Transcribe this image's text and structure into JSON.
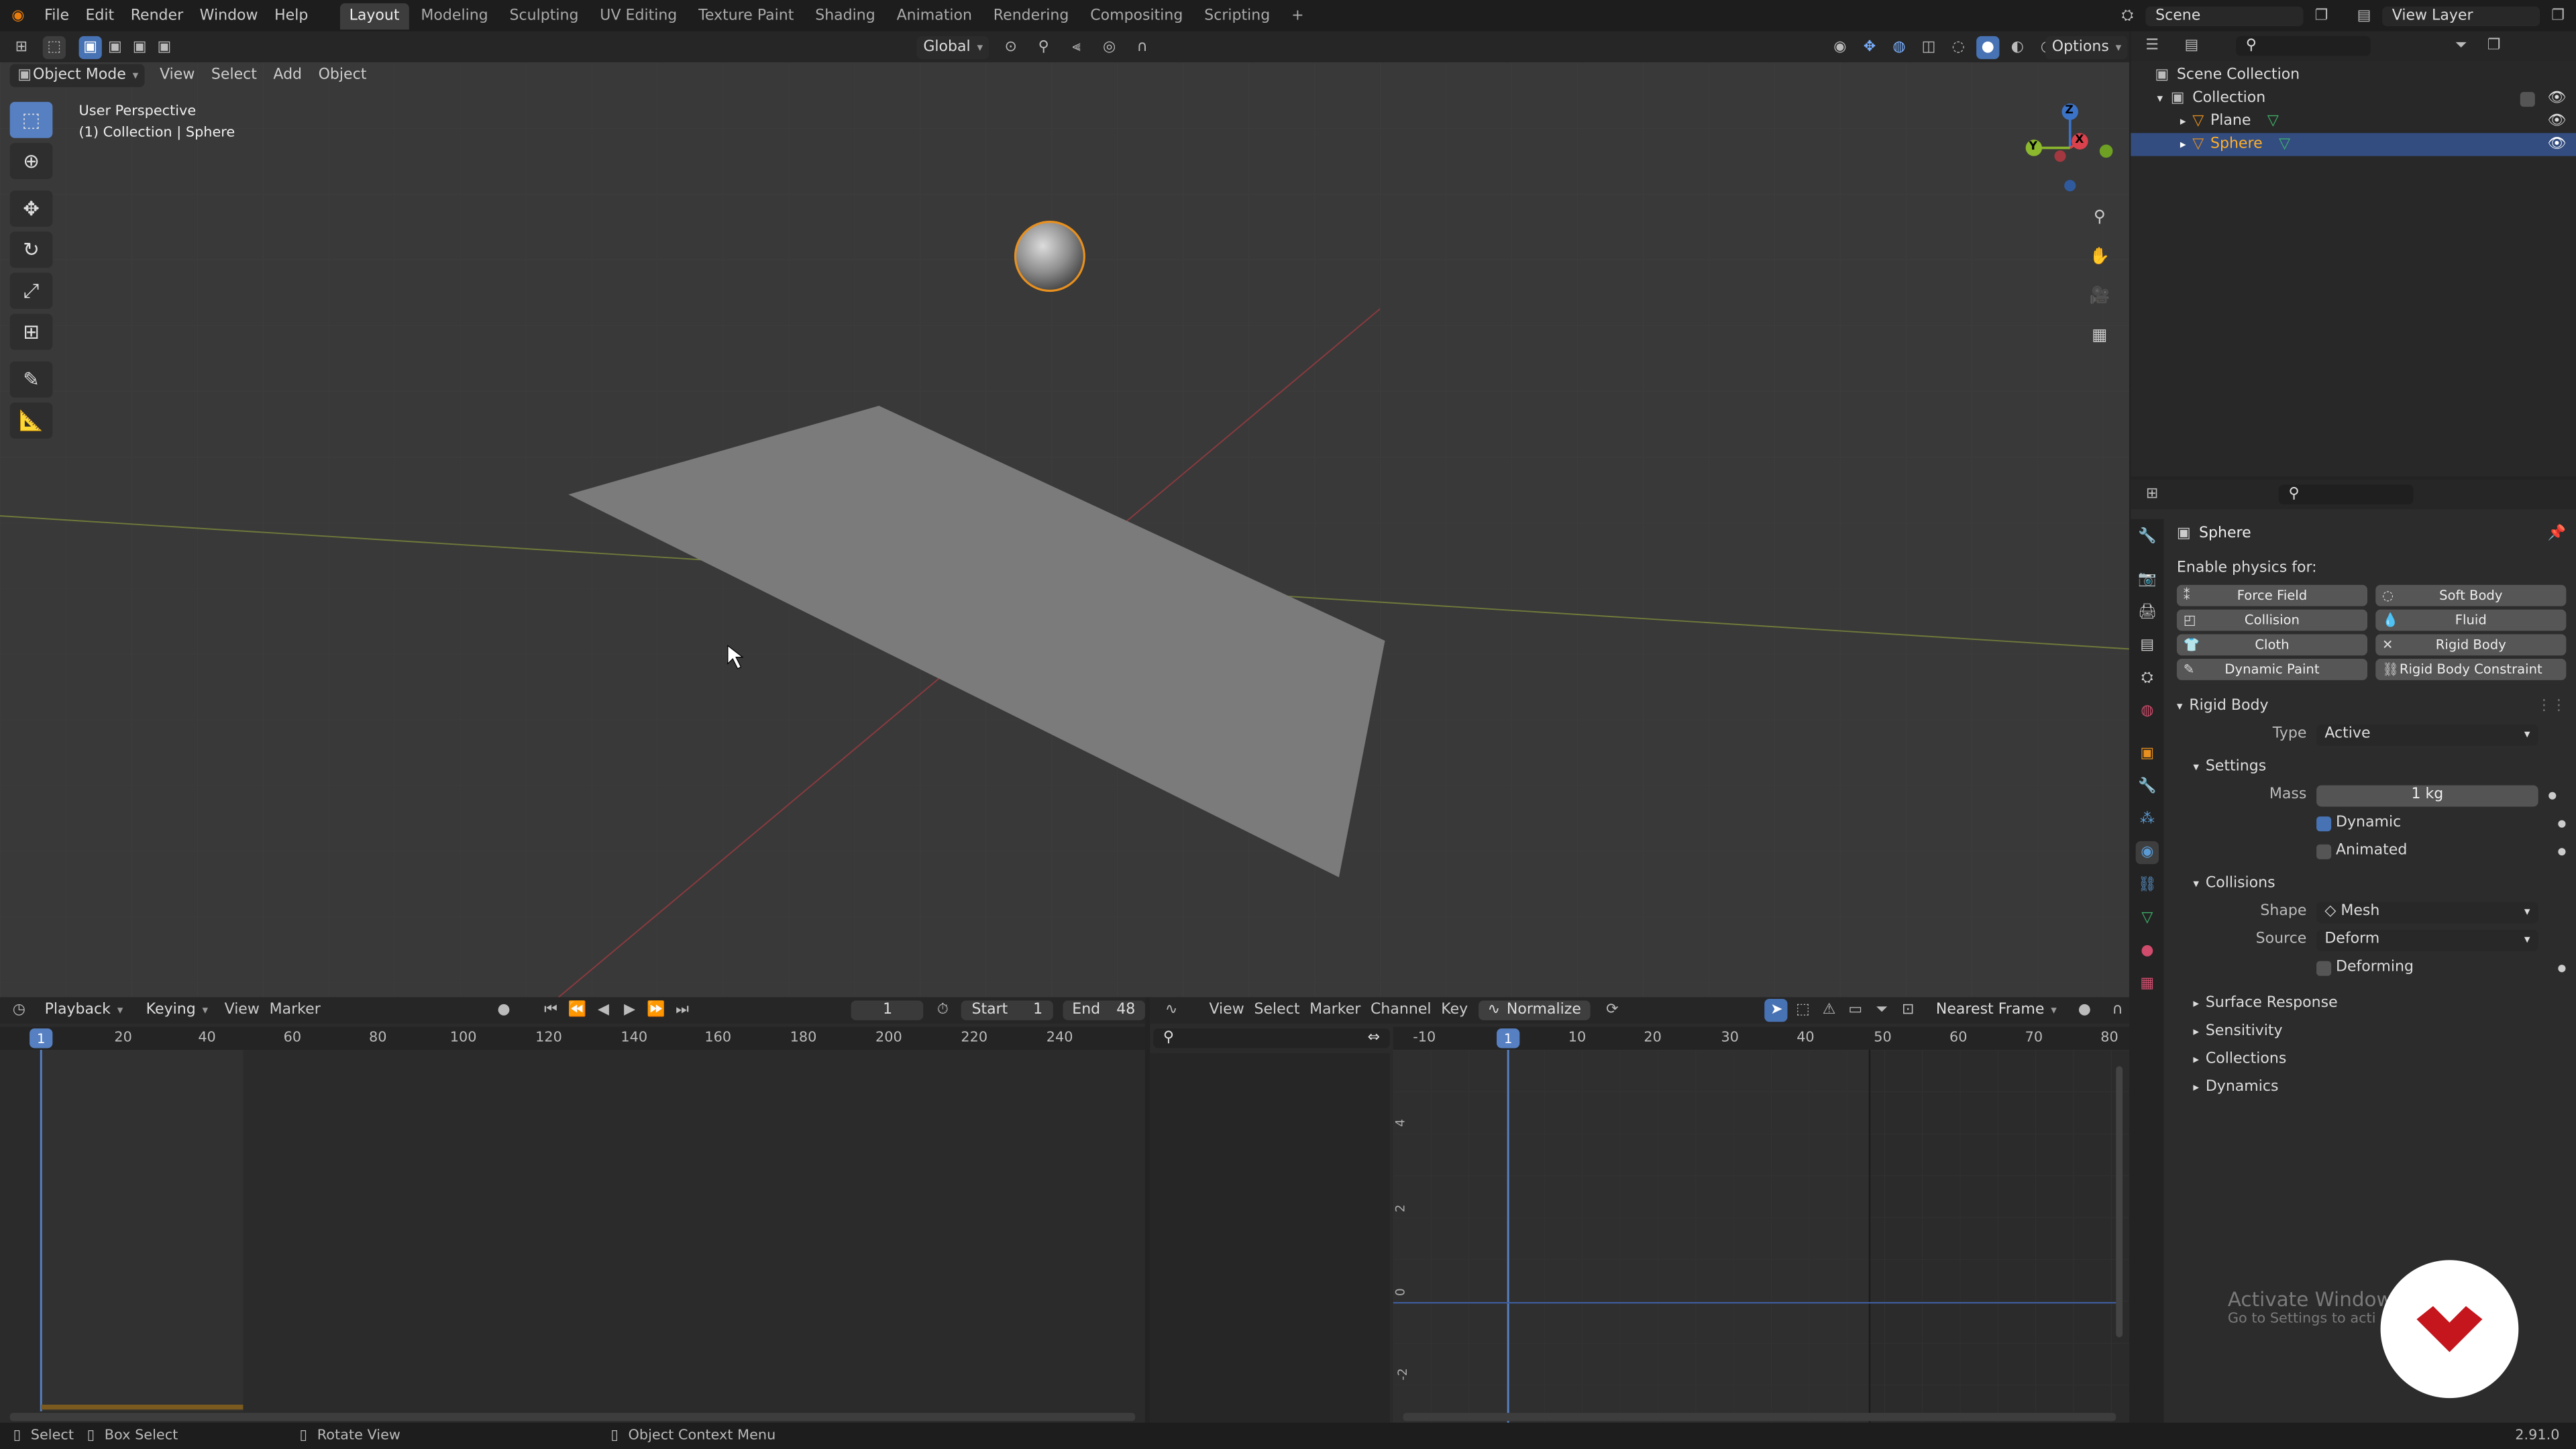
{
  "topbar": {
    "menu": [
      "File",
      "Edit",
      "Render",
      "Window",
      "Help"
    ],
    "workspaces": [
      "Layout",
      "Modeling",
      "Sculpting",
      "UV Editing",
      "Texture Paint",
      "Shading",
      "Animation",
      "Rendering",
      "Compositing",
      "Scripting"
    ],
    "active_workspace": "Layout",
    "add_tab": "+",
    "scene": "Scene",
    "view_layer": "View Layer"
  },
  "viewport_header": {
    "mode": "Object Mode",
    "menu": [
      "View",
      "Select",
      "Add",
      "Object"
    ],
    "transform_orientation": "Global",
    "options": "Options"
  },
  "viewport": {
    "perspective": "User Perspective",
    "context": "(1) Collection | Sphere",
    "gizmo": {
      "x": "X",
      "y": "Y",
      "z": "Z"
    }
  },
  "outliner": {
    "root": "Scene Collection",
    "collection": "Collection",
    "items": [
      {
        "label": "Plane",
        "selected": false
      },
      {
        "label": "Sphere",
        "selected": true
      }
    ]
  },
  "properties": {
    "object_name": "Sphere",
    "enable_physics_label": "Enable physics for:",
    "physics_buttons": [
      "Force Field",
      "Soft Body",
      "Collision",
      "Fluid",
      "Cloth",
      "Rigid Body",
      "Dynamic Paint",
      "Rigid Body Constraint"
    ],
    "rigid_body": {
      "title": "Rigid Body",
      "type_label": "Type",
      "type_value": "Active",
      "settings_title": "Settings",
      "mass_label": "Mass",
      "mass_value": "1 kg",
      "dynamic_label": "Dynamic",
      "dynamic_checked": true,
      "animated_label": "Animated",
      "animated_checked": false,
      "collisions_title": "Collisions",
      "shape_label": "Shape",
      "shape_value": "Mesh",
      "source_label": "Source",
      "source_value": "Deform",
      "deforming_label": "Deforming",
      "deforming_checked": false,
      "collapsed_panels": [
        "Surface Response",
        "Sensitivity",
        "Collections",
        "Dynamics"
      ]
    }
  },
  "timeline": {
    "menu": [
      "Playback",
      "Keying",
      "View",
      "Marker"
    ],
    "current_frame": "1",
    "start_label": "Start",
    "start_value": "1",
    "end_label": "End",
    "end_value": "48",
    "ruler_ticks": [
      "20",
      "40",
      "60",
      "80",
      "100",
      "120",
      "140",
      "160",
      "180",
      "200",
      "220",
      "240"
    ],
    "frame_badge": "1"
  },
  "graph_editor": {
    "menu": [
      "View",
      "Select",
      "Marker",
      "Channel",
      "Key"
    ],
    "normalize": "Normalize",
    "snap": "Nearest Frame",
    "ruler_ticks": [
      "-10",
      "10",
      "20",
      "30",
      "40",
      "50",
      "60",
      "70",
      "80"
    ],
    "frame_badge": "1",
    "y_ticks": [
      "4",
      "2",
      "0",
      "-2"
    ]
  },
  "statusbar": {
    "select": "Select",
    "box_select": "Box Select",
    "rotate_view": "Rotate View",
    "context_menu": "Object Context Menu",
    "version": "2.91.0"
  },
  "watermark": {
    "title": "Activate Windows",
    "subtitle": "Go to Settings to activate Windows."
  },
  "colors": {
    "accent": "#4772b3",
    "selection": "#334d80",
    "x_axis": "#d9424c",
    "y_axis": "#8bb82d",
    "z_axis": "#3b73c8",
    "sphere_outline": "#e8901f"
  }
}
